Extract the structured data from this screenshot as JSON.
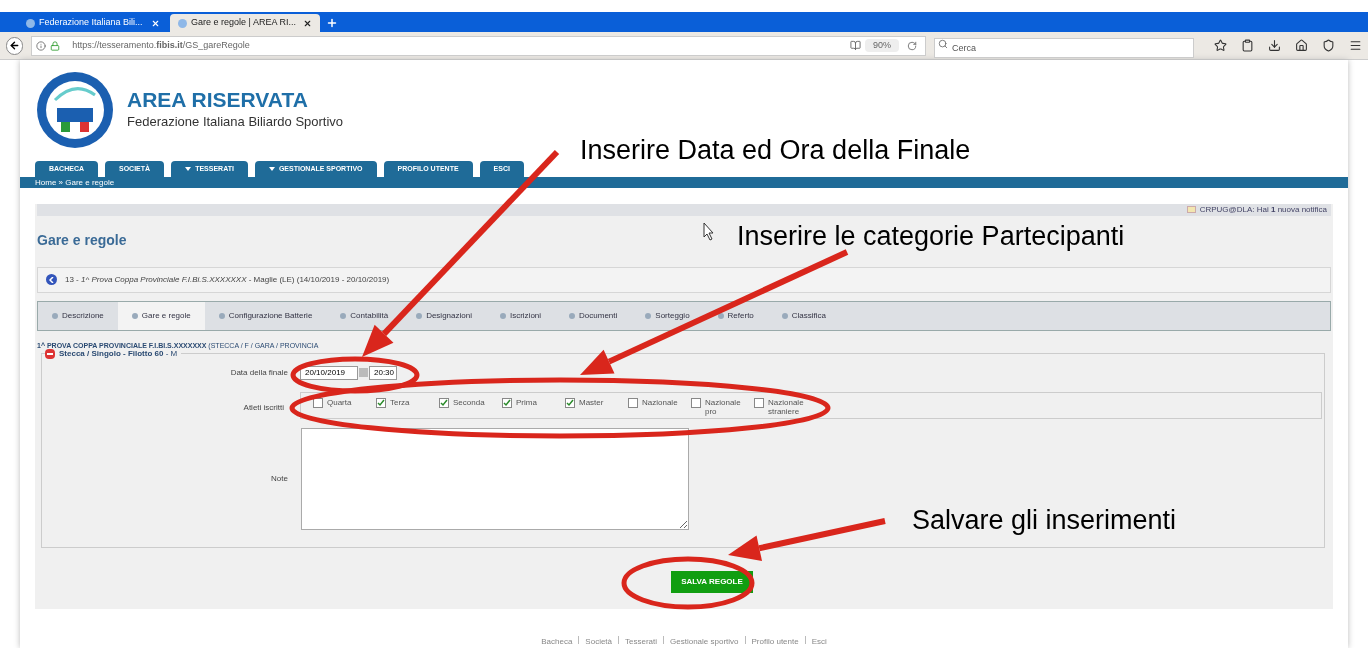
{
  "browser": {
    "tabs": [
      {
        "title": "Federazione Italiana Bili...",
        "selected": false
      },
      {
        "title": "Gare e regole | AREA RI...",
        "selected": true
      }
    ],
    "url": "https://tesseramento.**fibis.it**/GS_gareRegole",
    "zoom": "90%",
    "search": {
      "placeholder": "Cerca"
    }
  },
  "header": {
    "title": "AREA RISERVATA",
    "subtitle": "Federazione Italiana Biliardo Sportivo",
    "nav": [
      {
        "label": "BACHECA",
        "has_menu": false
      },
      {
        "label": "SOCIETÀ",
        "has_menu": false
      },
      {
        "label": "TESSERATI",
        "has_menu": true
      },
      {
        "label": "GESTIONALE SPORTIVO",
        "has_menu": true
      },
      {
        "label": "PROFILO UTENTE",
        "has_menu": false
      },
      {
        "label": "ESCI",
        "has_menu": false
      }
    ],
    "breadcrumb": "Home » Gare e regole"
  },
  "notification": "CRPUG@DLA: Hai **1** nuova notifica",
  "page_title": "Gare e regole",
  "event": "13 - *1^ Prova Coppa Provinciale F.I.Bi.S.XXXXXXX* - Maglie (LE) (14/10/2019 - 20/10/2019)",
  "tabs": [
    {
      "label": "Descrizione",
      "selected": false
    },
    {
      "label": "Gare e regole",
      "selected": true
    },
    {
      "label": "Configurazione Batterie",
      "selected": false
    },
    {
      "label": "Contabilità",
      "selected": false
    },
    {
      "label": "Designazioni",
      "selected": false
    },
    {
      "label": "Iscrizioni",
      "selected": false
    },
    {
      "label": "Documenti",
      "selected": false
    },
    {
      "label": "Sorteggio",
      "selected": false
    },
    {
      "label": "Referto",
      "selected": false
    },
    {
      "label": "Classifica",
      "selected": false
    }
  ],
  "competition": {
    "legend": "**1^ PROVA COPPA PROVINCIALE F.I.BI.S.XXXXXXX** (STECCA / F / GARA / PROVINCIA",
    "section": {
      "legend": "**Stecca / Singolo - Filotto 60** - M",
      "expanded": true,
      "date_label": "Data della finale",
      "date": "20/10/2019",
      "time": "20:30",
      "athletes_label": "Atleti iscritti",
      "categories": [
        {
          "label": "Quarta",
          "checked": false
        },
        {
          "label": "Terza",
          "checked": true
        },
        {
          "label": "Seconda",
          "checked": true
        },
        {
          "label": "Prima",
          "checked": true
        },
        {
          "label": "Master",
          "checked": true
        },
        {
          "label": "Nazionale",
          "checked": false
        },
        {
          "label": "Nazionale pro",
          "checked": false
        },
        {
          "label": "Nazionale straniere",
          "checked": false
        }
      ],
      "notes_label": "Note"
    }
  },
  "save_button": "SALVA REGOLE",
  "footer": [
    "Bacheca",
    "Società",
    "Tesserati",
    "Gestionale sportivo",
    "Profilo utente",
    "Esci"
  ],
  "annotations": [
    "Inserire Data ed Ora della Finale",
    "Inserire le categorie Partecipanti",
    "Salvare gli inserimenti"
  ]
}
